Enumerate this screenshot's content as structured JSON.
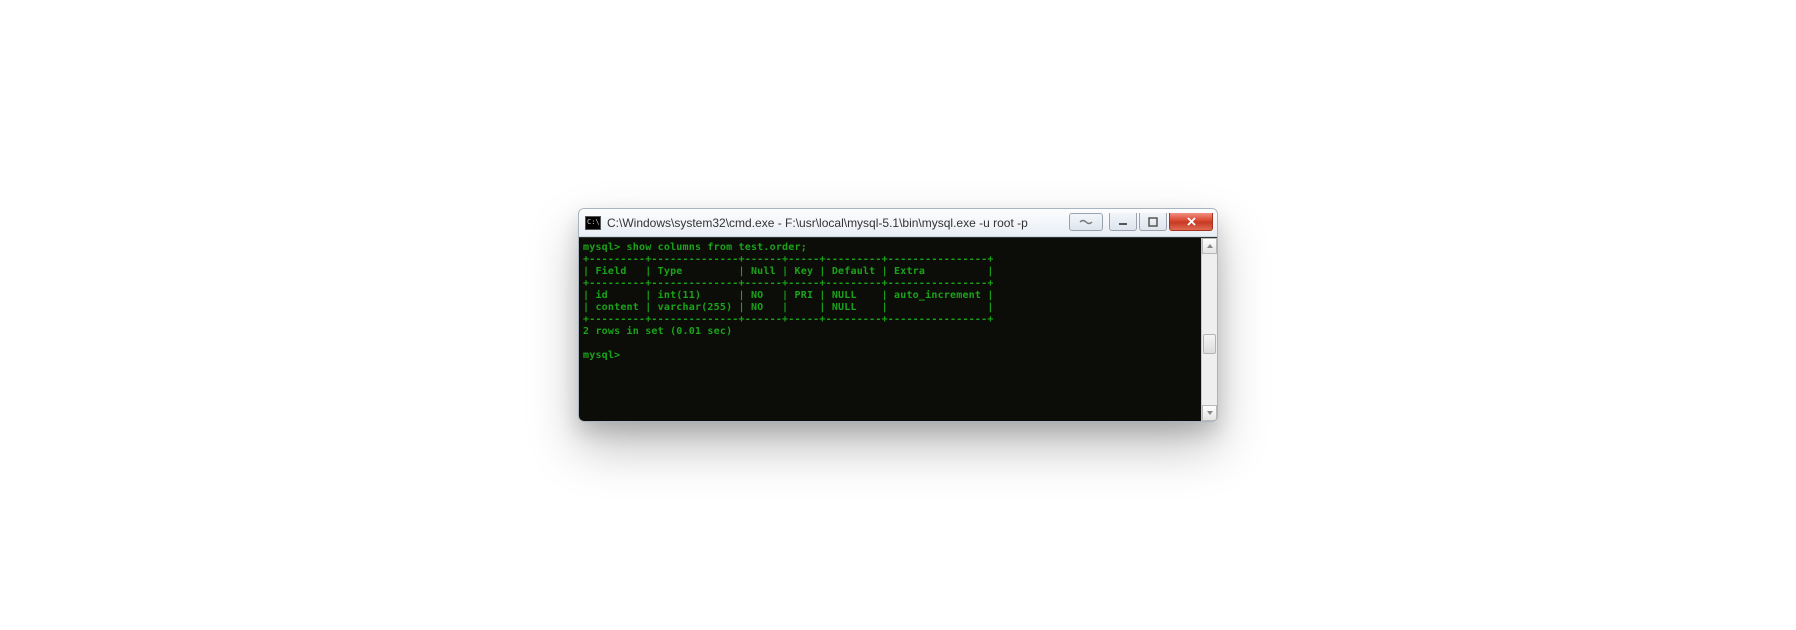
{
  "window": {
    "title": "C:\\Windows\\system32\\cmd.exe - F:\\usr\\local\\mysql-5.1\\bin\\mysql.exe  -u root -p"
  },
  "terminal": {
    "prompt1": "mysql> show columns from test.order;",
    "border_top": "+---------+--------------+------+-----+---------+----------------+",
    "header_row": "| Field   | Type         | Null | Key | Default | Extra          |",
    "border_mid": "+---------+--------------+------+-----+---------+----------------+",
    "row1": "| id      | int(11)      | NO   | PRI | NULL    | auto_increment |",
    "row2": "| content | varchar(255) | NO   |     | NULL    |                |",
    "border_bot": "+---------+--------------+------+-----+---------+----------------+",
    "status": "2 rows in set (0.01 sec)",
    "blank": "",
    "prompt2": "mysql>"
  },
  "chart_data": {
    "type": "table",
    "title": "show columns from test.order",
    "columns": [
      "Field",
      "Type",
      "Null",
      "Key",
      "Default",
      "Extra"
    ],
    "rows": [
      [
        "id",
        "int(11)",
        "NO",
        "PRI",
        "NULL",
        "auto_increment"
      ],
      [
        "content",
        "varchar(255)",
        "NO",
        "",
        "NULL",
        ""
      ]
    ],
    "footer": "2 rows in set (0.01 sec)"
  }
}
